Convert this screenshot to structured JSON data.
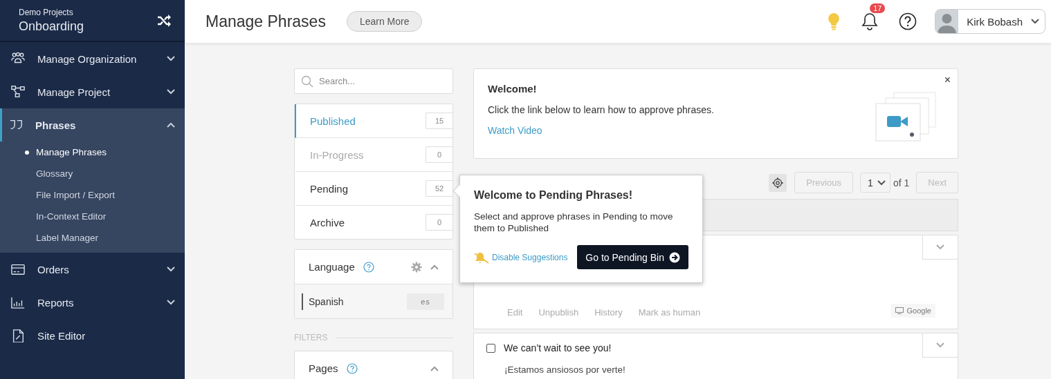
{
  "sidebar": {
    "project_label": "Demo Projects",
    "project_name": "Onboarding",
    "items": [
      {
        "label": "Manage Organization",
        "kind": "group",
        "expanded": false,
        "selected": false
      },
      {
        "label": "Manage Project",
        "kind": "group",
        "expanded": false,
        "selected": false
      },
      {
        "label": "Phrases",
        "kind": "group",
        "expanded": true,
        "selected": true,
        "children": [
          {
            "label": "Manage Phrases",
            "selected": true
          },
          {
            "label": "Glossary",
            "selected": false
          },
          {
            "label": "File Import / Export",
            "selected": false
          },
          {
            "label": "In-Context Editor",
            "selected": false
          },
          {
            "label": "Label Manager",
            "selected": false
          }
        ]
      },
      {
        "label": "Orders",
        "kind": "group",
        "expanded": false,
        "selected": false
      },
      {
        "label": "Reports",
        "kind": "group",
        "expanded": false,
        "selected": false
      },
      {
        "label": "Site Editor",
        "kind": "link",
        "selected": false
      }
    ]
  },
  "header": {
    "title": "Manage Phrases",
    "learn_more": "Learn More",
    "notification_count": "17",
    "user_name": "Kirk Bobash"
  },
  "search": {
    "placeholder": "Search..."
  },
  "bins": [
    {
      "label": "Published",
      "count": "15",
      "selected": true,
      "disabled": false
    },
    {
      "label": "In-Progress",
      "count": "0",
      "selected": false,
      "disabled": true
    },
    {
      "label": "Pending",
      "count": "52",
      "selected": false,
      "disabled": false
    },
    {
      "label": "Archive",
      "count": "0",
      "selected": false,
      "disabled": false
    }
  ],
  "language": {
    "title": "Language",
    "expanded": true,
    "items": [
      {
        "name": "Spanish",
        "code": "es"
      }
    ]
  },
  "filters_label": "FILTERS",
  "pages": {
    "title": "Pages",
    "expanded": true
  },
  "welcome": {
    "title": "Welcome!",
    "text": "Click the link below to learn how to approve phrases.",
    "link": "Watch Video",
    "close": "×"
  },
  "pagination": {
    "previous": "Previous",
    "previous_disabled": true,
    "page": "1",
    "of": "of 1",
    "next": "Next",
    "next_disabled": true
  },
  "phrases": [
    {
      "kind": "actions",
      "actions": [
        "Edit",
        "Unpublish",
        "History",
        "Mark as human"
      ],
      "provider": "Google"
    },
    {
      "kind": "source",
      "checked": false,
      "source": "We can’t wait to see you!",
      "translation": "¡Estamos ansiosos por verte!"
    }
  ],
  "popover": {
    "title": "Welcome to Pending Phrases!",
    "text": "Select and approve phrases in Pending to move them to Published",
    "disable_link": "Disable Suggestions",
    "button": "Go to Pending Bin"
  }
}
